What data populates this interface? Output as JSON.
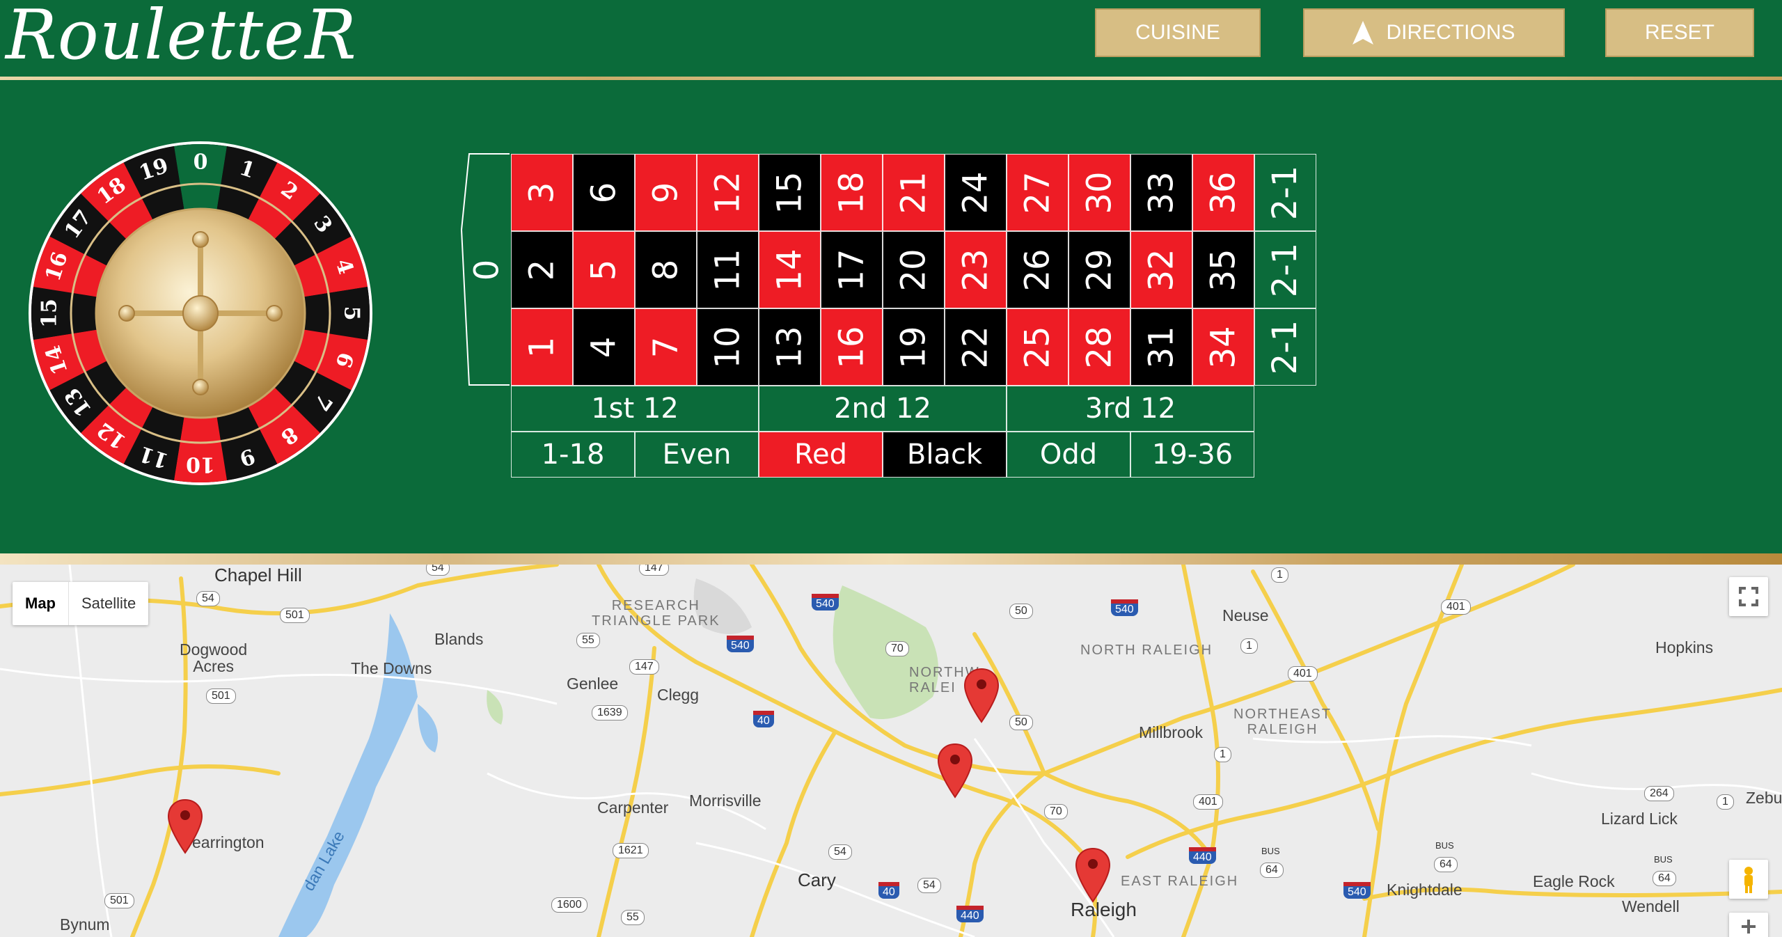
{
  "app": {
    "logo_text": "RouletteR"
  },
  "header": {
    "buttons": {
      "cuisine": "CUISINE",
      "directions": "DIRECTIONS",
      "reset": "RESET"
    },
    "colors": {
      "felt": "#0b6b3a",
      "button_bg": "#d7be84",
      "gold": "#d2b57a"
    }
  },
  "wheel": {
    "numbers": [
      "0",
      "1",
      "2",
      "3",
      "4",
      "5",
      "6",
      "7",
      "8",
      "9",
      "10",
      "11",
      "12",
      "13",
      "14",
      "15",
      "16",
      "17",
      "18",
      "19"
    ],
    "colors": {
      "red": "#ee1c25",
      "black": "#111111",
      "green": "#0b6b3a"
    }
  },
  "board": {
    "zero": "0",
    "rows": [
      [
        "3",
        "6",
        "9",
        "12",
        "15",
        "18",
        "21",
        "24",
        "27",
        "30",
        "33",
        "36"
      ],
      [
        "2",
        "5",
        "8",
        "11",
        "14",
        "17",
        "20",
        "23",
        "26",
        "29",
        "32",
        "35"
      ],
      [
        "1",
        "4",
        "7",
        "10",
        "13",
        "16",
        "19",
        "22",
        "25",
        "28",
        "31",
        "34"
      ]
    ],
    "row_colors": [
      [
        "red",
        "black",
        "red",
        "red",
        "black",
        "red",
        "red",
        "black",
        "red",
        "red",
        "black",
        "red"
      ],
      [
        "black",
        "red",
        "black",
        "black",
        "red",
        "black",
        "black",
        "red",
        "black",
        "black",
        "red",
        "black"
      ],
      [
        "red",
        "black",
        "red",
        "black",
        "black",
        "red",
        "black",
        "black",
        "red",
        "red",
        "black",
        "red"
      ]
    ],
    "column_bets": [
      "2-1",
      "2-1",
      "2-1"
    ],
    "dozens": [
      "1st 12",
      "2nd 12",
      "3rd 12"
    ],
    "outside_bets": [
      {
        "label": "1-18",
        "color": "green"
      },
      {
        "label": "Even",
        "color": "green"
      },
      {
        "label": "Red",
        "color": "red"
      },
      {
        "label": "Black",
        "color": "black"
      },
      {
        "label": "Odd",
        "color": "green"
      },
      {
        "label": "19-36",
        "color": "green"
      }
    ]
  },
  "map": {
    "type_controls": {
      "map": "Map",
      "satellite": "Satellite"
    },
    "places": {
      "chapel_hill": "Chapel Hill",
      "blands": "Blands",
      "dogwood_acres": "Dogwood\nAcres",
      "the_downs": "The Downs",
      "research_triangle_park": "RESEARCH\nTRIANGLE PARK",
      "genlee": "Genlee",
      "clegg": "Clegg",
      "north_raleigh": "NORTH RALEIGH",
      "northwest_raleigh": "NORTHW\nRALEI",
      "neuse": "Neuse",
      "hopkins": "Hopkins",
      "northeast_raleigh": "NORTHEAST\nRALEIGH",
      "millbrook": "Millbrook",
      "carpenter": "Carpenter",
      "morrisville": "Morrisville",
      "pearrington": "earrington",
      "cary": "Cary",
      "raleigh": "Raleigh",
      "east_raleigh": "EAST RALEIGH",
      "knightdale": "Knightdale",
      "eagle_rock": "Eagle Rock",
      "wendell": "Wendell",
      "lizard_lick": "Lizard Lick",
      "zebulon": "Zebul",
      "bynum": "Bynum",
      "jordan_lake": "dan Lake"
    },
    "shields": {
      "s54a": "54",
      "s147a": "147",
      "s54b": "54",
      "s501a": "501",
      "s55a": "55",
      "s147b": "147",
      "s501b": "501",
      "s1639": "1639",
      "s70a": "70",
      "s50a": "50",
      "s50b": "50",
      "s1a": "1",
      "s1b": "1",
      "s401a": "401",
      "s401b": "401",
      "s1c": "1",
      "s70b": "70",
      "s401c": "401",
      "s54c": "54",
      "s1621": "1621",
      "s54d": "54",
      "s1600": "1600",
      "s55b": "55",
      "s501c": "501",
      "s64a": "64",
      "s64b": "64",
      "s64c": "64",
      "s264": "264",
      "s1d": "1"
    },
    "interstates": {
      "i540a": "540",
      "i540b": "540",
      "i540c": "540",
      "i540d": "540",
      "i40a": "40",
      "i40b": "40",
      "i440a": "440",
      "i440b": "440"
    },
    "bus_label": "BUS",
    "pin_color": "#e53935"
  }
}
